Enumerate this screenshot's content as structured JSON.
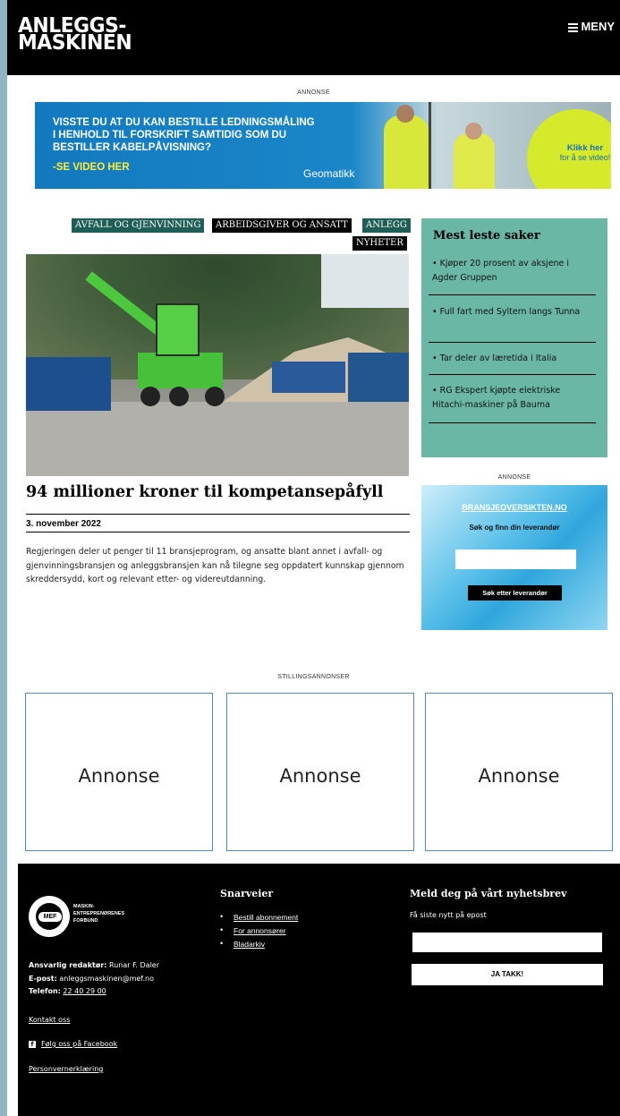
{
  "header": {
    "logo_line1": "ANLEGGS-",
    "logo_line2": "MASKINEN",
    "menu_label": "MENY"
  },
  "top_ad": {
    "label": "ANNONSE",
    "text_line1": "VISSTE DU AT DU KAN BESTILLE LEDNINGSMÅLING",
    "text_line2": "I HENHOLD TIL FORSKRIFT SAMTIDIG SOM DU",
    "text_line3": "BESTILLER KABELPÅVISNING?",
    "cta": "-SE VIDEO HER",
    "brand": "Geomatikk",
    "circle_bold": "Klikk her",
    "circle_text": "for å se video!"
  },
  "article": {
    "tags": [
      "AVFALL OG GJENVINNING",
      "ARBEIDSGIVER OG ANSATT",
      "ANLEGG",
      "NYHETER"
    ],
    "headline": "94 millioner kroner til kompetansepåfyll",
    "date": "3. november 2022",
    "lead": "Regjeringen deler ut penger til 11 bransjeprogram, og ansatte blant annet i avfall- og gjenvinningsbransjen og anleggsbransjen kan nå tilegne seg oppdatert kunnskap gjennom skreddersydd, kort og relevant etter- og videreutdanning."
  },
  "most_read": {
    "title": "Mest leste saker",
    "items": [
      "• Kjøper 20 prosent av aksjene i Agder Gruppen",
      "• Full fart med Syltern langs Tunna",
      "• Tar deler av læretida i Italia",
      "• RG Ekspert kjøpte elektriske Hitachi-maskiner på Bauma"
    ]
  },
  "side_ad": {
    "label": "ANNONSE",
    "title": "BRANSJEOVERSIKTEN.NO",
    "subtitle": "Søk og finn din leverandør",
    "button": "Søk etter leverandør"
  },
  "job_ads": {
    "label": "STILLINGSANNONSER",
    "boxes": [
      "Annonse",
      "Annonse",
      "Annonse"
    ]
  },
  "footer": {
    "org_name_1": "MASKIN-",
    "org_name_2": "ENTREPRENØRENES",
    "org_name_3": "FORBUND",
    "logo_text": "MEF",
    "editor_label": "Ansvarlig redaktør:",
    "editor_name": "Runar F. Daler",
    "email_label": "E-post:",
    "email": "anleggsmaskinen@mef.no",
    "phone_label": "Telefon:",
    "phone": "22 40 29 00",
    "contact": "Kontakt oss",
    "facebook": "Følg oss på Facebook",
    "privacy": "Personvernerklæring",
    "shortcuts_title": "Snarveier",
    "shortcuts": [
      "Bestill abonnement",
      "For annonsører",
      "Bladarkiv"
    ],
    "newsletter_title": "Meld deg på vårt nyhetsbrev",
    "newsletter_sub": "Få siste nytt på epost",
    "newsletter_button": "JA TAKK!"
  },
  "colors": {
    "tag_green": "#1f5e56",
    "most_read_bg": "#6bb7a6",
    "page_side": "#8fb5c3"
  }
}
